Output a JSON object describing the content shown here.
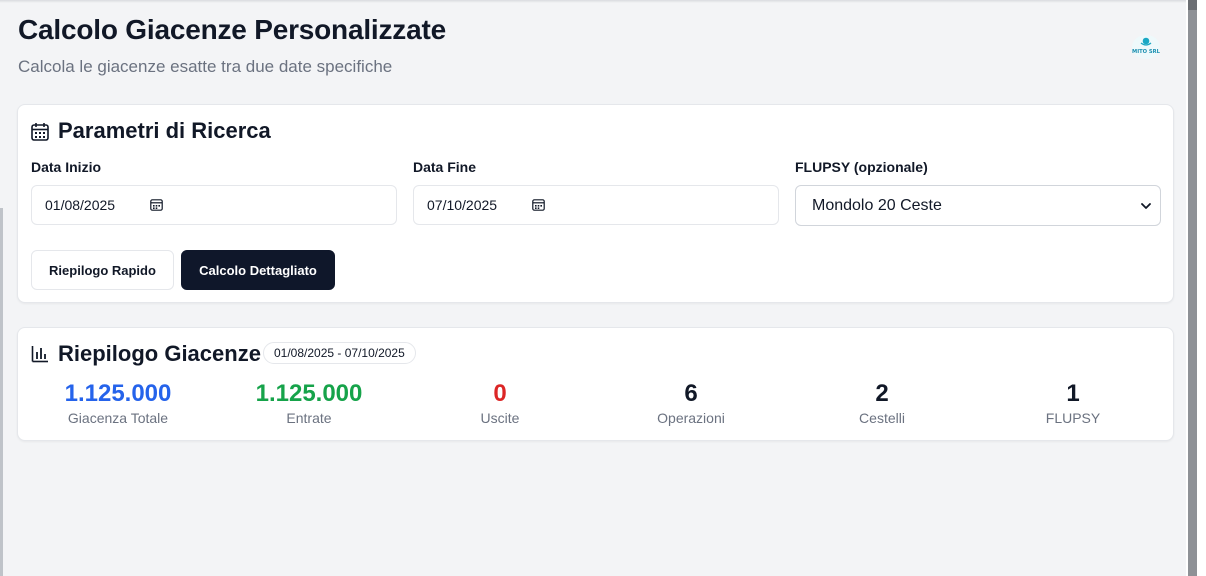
{
  "header": {
    "title": "Calcolo Giacenze Personalizzate",
    "subtitle": "Calcola le giacenze esatte tra due date specifiche",
    "logo_text": "MITO SRL"
  },
  "params": {
    "title": "Parametri di Ricerca",
    "start_label": "Data Inizio",
    "start_value": "01/08/2025",
    "end_label": "Data Fine",
    "end_value": "07/10/2025",
    "flupsy_label": "FLUPSY (opzionale)",
    "flupsy_value": "Mondolo 20 Ceste",
    "quick_button": "Riepilogo Rapido",
    "detail_button": "Calcolo Dettagliato"
  },
  "summary": {
    "title": "Riepilogo Giacenze",
    "range": "01/08/2025 - 07/10/2025",
    "stats": [
      {
        "value": "1.125.000",
        "label": "Giacenza Totale",
        "color": "#2563eb"
      },
      {
        "value": "1.125.000",
        "label": "Entrate",
        "color": "#16a34a"
      },
      {
        "value": "0",
        "label": "Uscite",
        "color": "#dc2626"
      },
      {
        "value": "6",
        "label": "Operazioni",
        "color": "#111827"
      },
      {
        "value": "2",
        "label": "Cestelli",
        "color": "#111827"
      },
      {
        "value": "1",
        "label": "FLUPSY",
        "color": "#111827"
      }
    ]
  },
  "icons": {
    "params": "calendar-icon",
    "summary": "bar-chart-icon",
    "date": "calendar-picker-icon",
    "select": "chevron-down-icon"
  }
}
